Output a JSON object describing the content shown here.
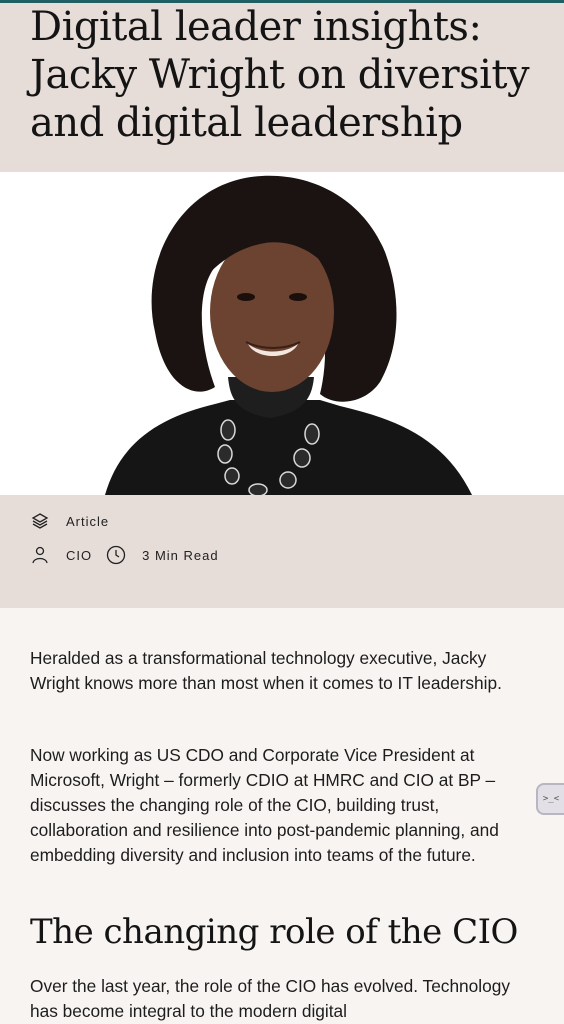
{
  "article": {
    "title": "Digital leader insights: Jacky Wright on diversity and digital leadership",
    "type_label": "Article",
    "category_label": "CIO",
    "read_time": "3 Min Read",
    "paragraphs": [
      "Heralded as a transformational technology executive, Jacky Wright knows more than most when it comes to IT leadership.",
      "Now working as US CDO and Corporate Vice President at Microsoft, Wright – formerly CDIO at HMRC and CIO at BP – discusses the changing role of the CIO, building trust, collaboration and resilience into post-pandemic planning, and embedding diversity and inclusion into teams of the future."
    ],
    "section_heading": "The changing role of the CIO",
    "section_paragraph": "Over the last year, the role of the CIO has evolved. Technology has become integral to the modern digital"
  },
  "widget": {
    "glyph": ">_<"
  },
  "icons": {
    "type": "layers-icon",
    "category": "user-icon",
    "time": "clock-icon"
  },
  "colors": {
    "accent": "#1f5e63",
    "hero_bg": "#e6dcd8",
    "page_bg": "#f8f4f2"
  }
}
